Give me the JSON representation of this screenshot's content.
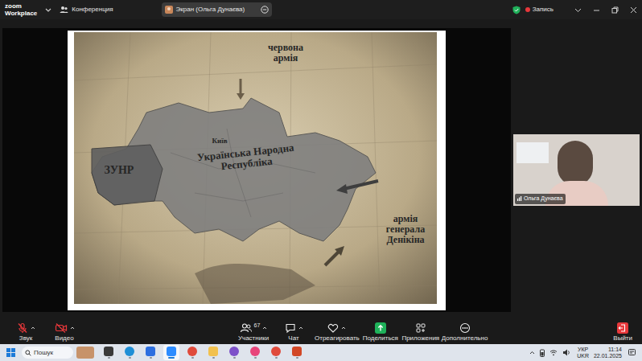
{
  "top_bar": {
    "logo": {
      "line1": "zoom",
      "line2": "Workplace"
    },
    "meeting": "Конференция",
    "screen_pill": "Экран (Ольга Дунаєва)",
    "recording": {
      "label": "Запись",
      "on": true
    }
  },
  "shared_screen": {
    "labels": [
      {
        "text": "червона армія",
        "kind": "army"
      },
      {
        "text": "ЗУНР",
        "kind": "region"
      },
      {
        "text": "Київ",
        "kind": "city"
      },
      {
        "text": "Українська Народна Республіка",
        "kind": "country"
      },
      {
        "text": "армія генерала Денікіна",
        "kind": "army"
      }
    ]
  },
  "participant": {
    "name": "Ольга Дунаєва"
  },
  "toolbar": {
    "left": [
      {
        "label": "Звук",
        "muted": true,
        "kind": "audio",
        "has_menu": true
      },
      {
        "label": "Видео",
        "muted": true,
        "kind": "video",
        "has_menu": true
      }
    ],
    "center": [
      {
        "label": "Участники",
        "count": "67",
        "has_menu": true,
        "kind": "participants"
      },
      {
        "label": "Чат",
        "has_menu": true,
        "kind": "chat"
      },
      {
        "label": "Отреагировать",
        "has_menu": true,
        "kind": "react"
      },
      {
        "label": "Поделиться",
        "has_menu": false,
        "kind": "share"
      },
      {
        "label": "Приложения",
        "has_menu": false,
        "kind": "apps"
      },
      {
        "label": "Дополнительно",
        "has_menu": false,
        "kind": "more"
      }
    ],
    "leave": {
      "label": "Выйти"
    }
  },
  "taskbar": {
    "search": {
      "placeholder": "Пошук"
    },
    "apps": [
      {
        "kind": "taskview",
        "selected": false,
        "color": "#3a3a3a"
      },
      {
        "kind": "edge",
        "selected": false,
        "color": "#1f8fd6"
      },
      {
        "kind": "meet",
        "selected": false,
        "color": "#2d6fe0"
      },
      {
        "kind": "zoom",
        "selected": true,
        "color": "#2d8cff"
      },
      {
        "kind": "chrome",
        "selected": false,
        "color": "#e04a3b"
      },
      {
        "kind": "folder",
        "selected": false,
        "color": "#f2c14e"
      },
      {
        "kind": "viber",
        "selected": false,
        "color": "#7d51c9"
      },
      {
        "kind": "paint",
        "selected": false,
        "color": "#e8447a"
      },
      {
        "kind": "chrome",
        "selected": false,
        "color": "#e04a3b"
      },
      {
        "kind": "powerpoint",
        "selected": false,
        "color": "#d24726"
      }
    ],
    "lang": {
      "line1": "УКР",
      "line2": "UKR"
    },
    "clock": {
      "time": "11:14",
      "date": "22.01.2025"
    }
  }
}
